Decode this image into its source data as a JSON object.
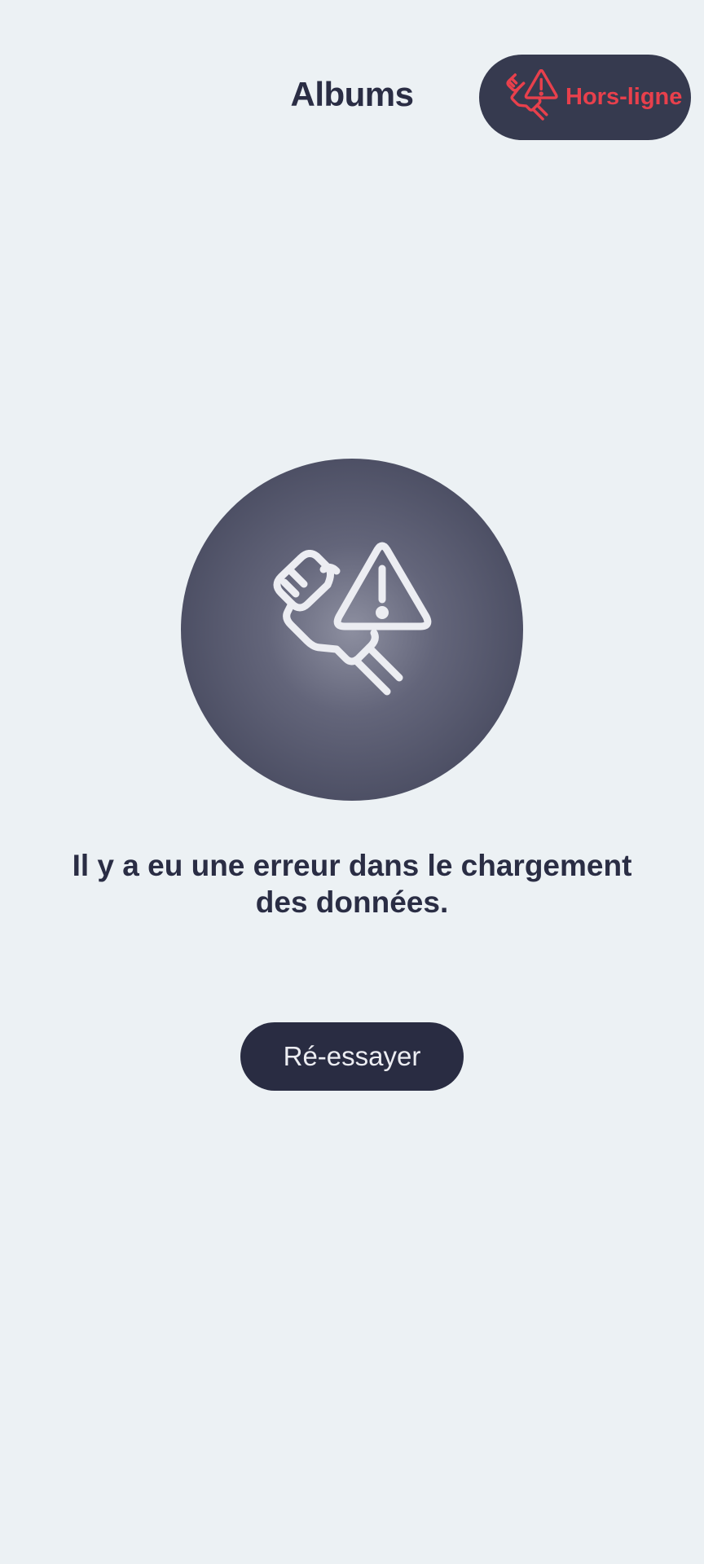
{
  "header": {
    "title": "Albums"
  },
  "status": {
    "label": "Hors-ligne",
    "icon": "offline-plug-warning-icon",
    "color": "#E8404C",
    "background": "#363A4F"
  },
  "error": {
    "icon": "unplugged-warning-icon",
    "message": "Il y a eu une erreur dans le chargement des données."
  },
  "actions": {
    "retry_label": "Ré-essayer"
  },
  "colors": {
    "background": "#ECF1F4",
    "text": "#2A2D44",
    "button": "#292C42"
  }
}
